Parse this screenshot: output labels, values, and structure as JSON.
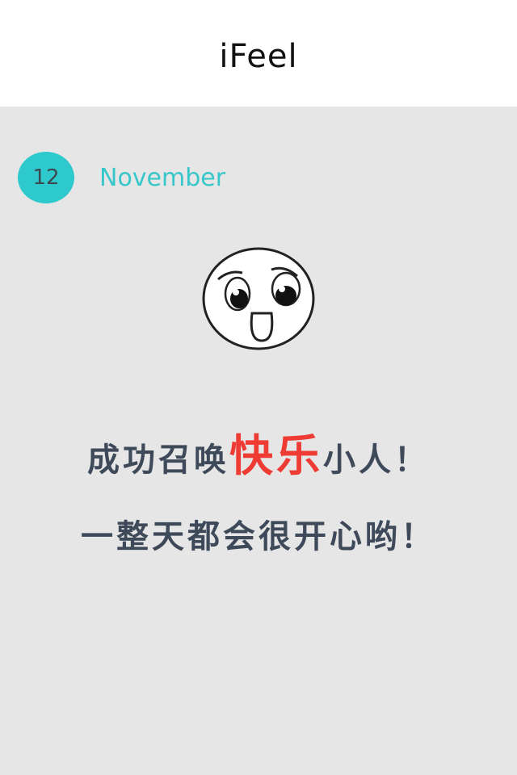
{
  "header": {
    "title": "iFeel"
  },
  "date": {
    "day": "12",
    "month": "November"
  },
  "face": {
    "icon": "happy-face-icon"
  },
  "message": {
    "line1_before": "成功召唤",
    "line1_highlight": "快乐",
    "line1_after": "小人！",
    "line2": "一整天都会很开心哟！"
  },
  "colors": {
    "accent": "#2ec9cc",
    "highlight": "#ee3b33",
    "text": "#3e4a5a",
    "background": "#e6e6e6"
  }
}
